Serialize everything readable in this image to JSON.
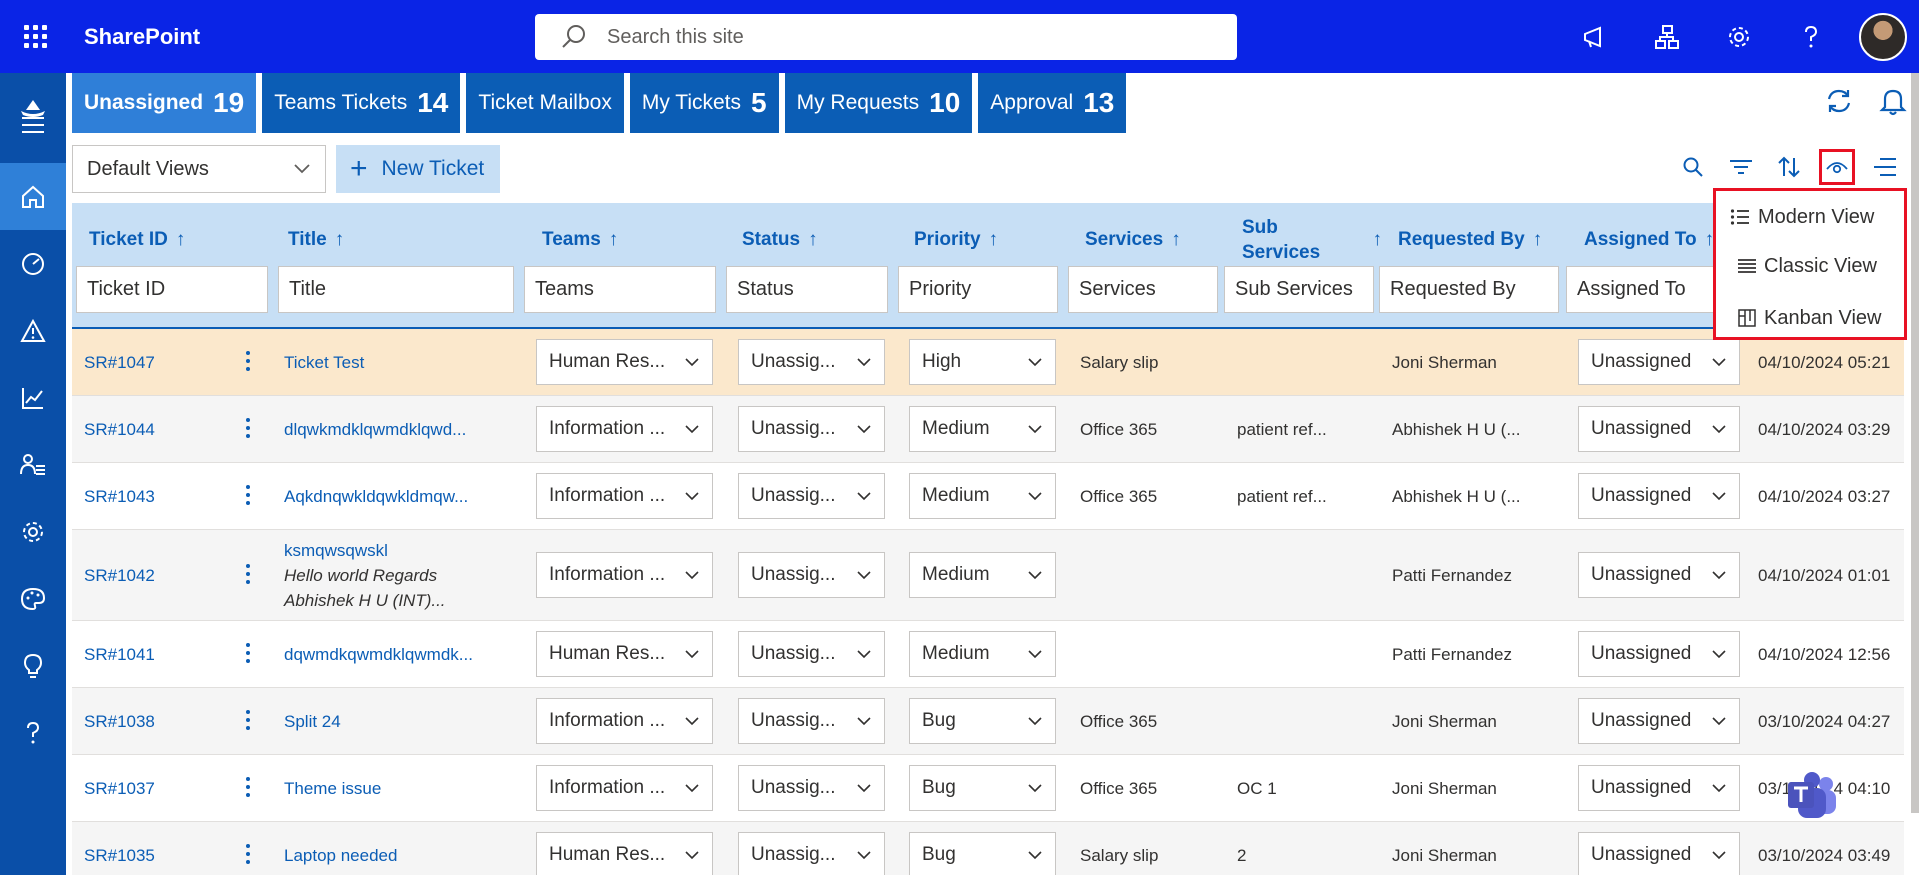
{
  "app": {
    "brand": "SharePoint",
    "search_placeholder": "Search this site"
  },
  "tabs": [
    {
      "label": "Unassigned",
      "count": "19"
    },
    {
      "label": "Teams Tickets",
      "count": "14"
    },
    {
      "label": "Ticket Mailbox",
      "count": ""
    },
    {
      "label": "My Tickets",
      "count": "5"
    },
    {
      "label": "My Requests",
      "count": "10"
    },
    {
      "label": "Approval",
      "count": "13"
    }
  ],
  "toolbar": {
    "view_dropdown": "Default Views",
    "new_ticket": "New Ticket"
  },
  "columns": [
    {
      "label": "Ticket ID",
      "filter": "Ticket ID"
    },
    {
      "label": "Title",
      "filter": "Title"
    },
    {
      "label": "Teams",
      "filter": "Teams"
    },
    {
      "label": "Status",
      "filter": "Status"
    },
    {
      "label": "Priority",
      "filter": "Priority"
    },
    {
      "label": "Services",
      "filter": "Services"
    },
    {
      "label": "Sub Services",
      "filter": "Sub Services"
    },
    {
      "label": "Requested By",
      "filter": "Requested By"
    },
    {
      "label": "Assigned To",
      "filter": "Assigned To"
    }
  ],
  "sort_arrow": "↑",
  "rows": [
    {
      "id": "SR#1047",
      "title": "Ticket Test",
      "team": "Human Res...",
      "status": "Unassig...",
      "priority": "High",
      "services": "Salary slip",
      "sub": "",
      "requested_by": "Joni Sherman",
      "assigned": "Unassigned",
      "date": "04/10/2024 05:21"
    },
    {
      "id": "SR#1044",
      "title": "dlqwkmdklqwmdklqwd...",
      "team": "Information ...",
      "status": "Unassig...",
      "priority": "Medium",
      "services": "Office 365",
      "sub": "patient ref...",
      "requested_by": "Abhishek H U (...",
      "assigned": "Unassigned",
      "date": "04/10/2024 03:29"
    },
    {
      "id": "SR#1043",
      "title": "Aqkdnqwkldqwkldmqw...",
      "team": "Information ...",
      "status": "Unassig...",
      "priority": "Medium",
      "services": "Office 365",
      "sub": "patient ref...",
      "requested_by": "Abhishek H U (...",
      "assigned": "Unassigned",
      "date": "04/10/2024 03:27"
    },
    {
      "id": "SR#1042",
      "title": "ksmqwsqwskl",
      "title_line2": "Hello world Regards",
      "title_line3": "Abhishek H U (INT)...",
      "team": "Information ...",
      "status": "Unassig...",
      "priority": "Medium",
      "services": "",
      "sub": "",
      "requested_by": "Patti Fernandez",
      "assigned": "Unassigned",
      "date": "04/10/2024 01:01"
    },
    {
      "id": "SR#1041",
      "title": "dqwmdkqwmdklqwmdk...",
      "team": "Human Res...",
      "status": "Unassig...",
      "priority": "Medium",
      "services": "",
      "sub": "",
      "requested_by": "Patti Fernandez",
      "assigned": "Unassigned",
      "date": "04/10/2024 12:56"
    },
    {
      "id": "SR#1038",
      "title": "Split 24",
      "team": "Information ...",
      "status": "Unassig...",
      "priority": "Bug",
      "services": "Office 365",
      "sub": "",
      "requested_by": "Joni Sherman",
      "assigned": "Unassigned",
      "date": "03/10/2024 04:27"
    },
    {
      "id": "SR#1037",
      "title": "Theme issue",
      "team": "Information ...",
      "status": "Unassig...",
      "priority": "Bug",
      "services": "Office 365",
      "sub": "OC 1",
      "requested_by": "Joni Sherman",
      "assigned": "Unassigned",
      "date": "03/10/2024 04:10"
    },
    {
      "id": "SR#1035",
      "title": "Laptop needed",
      "team": "Human Res...",
      "status": "Unassig...",
      "priority": "Bug",
      "services": "Salary slip",
      "sub": "2",
      "requested_by": "Joni Sherman",
      "assigned": "Unassigned",
      "date": "03/10/2024 03:49"
    }
  ],
  "view_menu": [
    {
      "label": "Modern View",
      "icon": "bulleted-list-icon"
    },
    {
      "label": "Classic View",
      "icon": "lines-icon"
    },
    {
      "label": "Kanban View",
      "icon": "kanban-board-icon"
    }
  ],
  "colors": {
    "topbar": "#0a24e6",
    "rail": "#0a4fa8",
    "tab": "#0b5db5",
    "tab_active": "#2f7fd8",
    "header": "#c7dff5",
    "highlight_row": "#fbe8cc",
    "alert": "#e81123"
  }
}
